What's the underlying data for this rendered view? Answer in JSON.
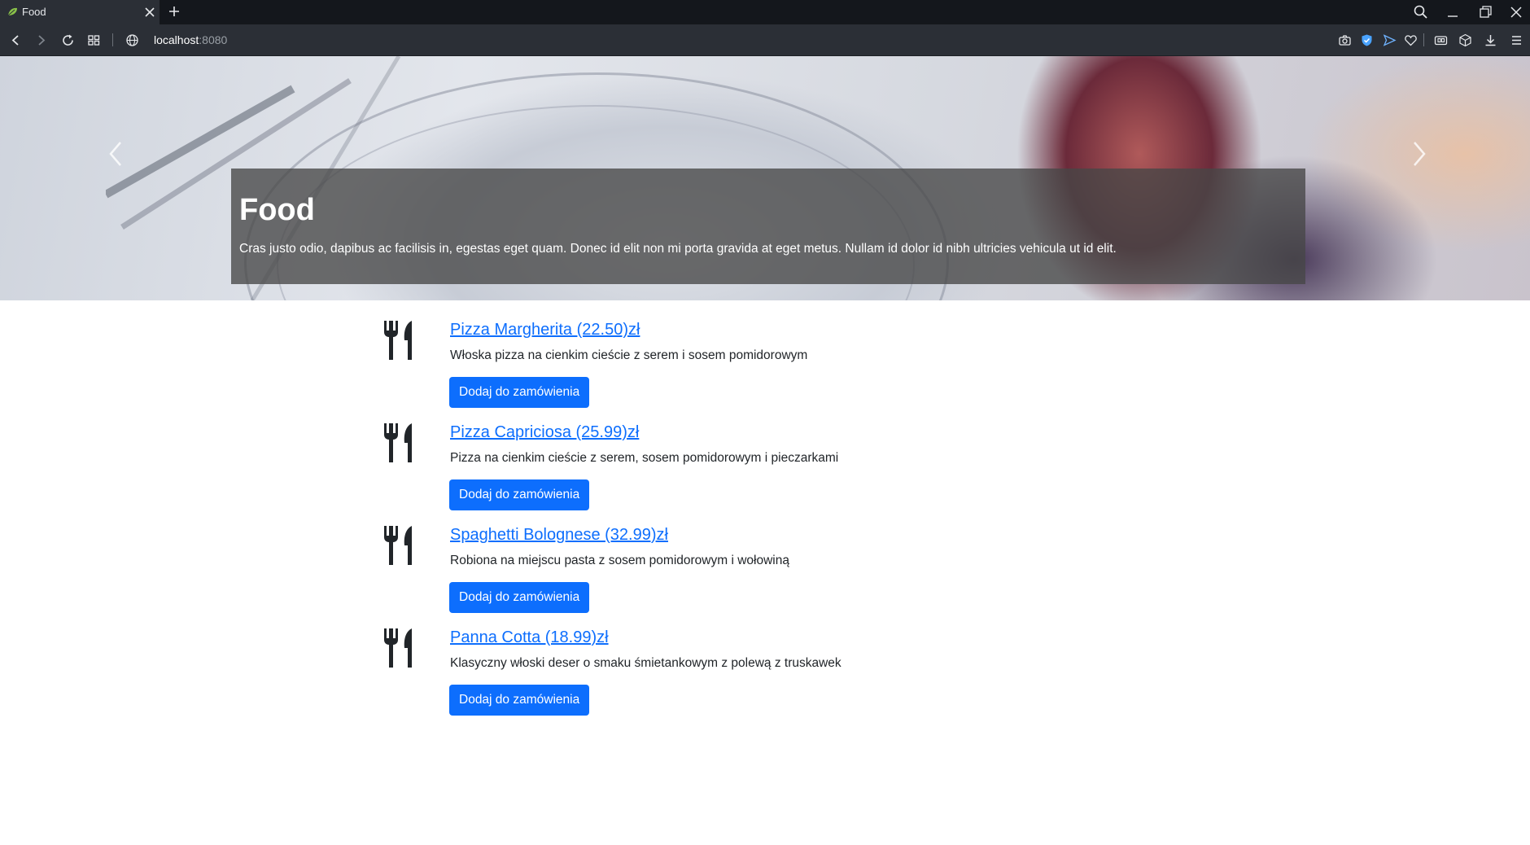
{
  "browser": {
    "tab_title": "Food",
    "url_host": "localhost",
    "url_port": ":8080",
    "icons": [
      "favicon-icon",
      "close-icon",
      "plus-icon",
      "search-icon",
      "minimize-icon",
      "restore-icon",
      "close-window-icon",
      "back-icon",
      "forward-icon",
      "reload-icon",
      "tiles-icon",
      "globe-icon",
      "camera-icon",
      "shield-icon",
      "send-icon",
      "heart-icon",
      "wallet-icon",
      "cube-icon",
      "download-icon",
      "menu-icon"
    ]
  },
  "hero": {
    "title": "Food",
    "text": "Cras justo odio, dapibus ac facilisis in, egestas eget quam. Donec id elit non mi porta gravida at eget metus. Nullam id dolor id nibh ultricies vehicula ut id elit.",
    "slides": 3,
    "active_slide": 1
  },
  "menu": {
    "button_label": "Dodaj do zamówienia",
    "items": [
      {
        "name": "Pizza Margherita (22.50)zł",
        "description": "Włoska pizza na cienkim cieście z serem i sosem pomidorowym"
      },
      {
        "name": "Pizza Capriciosa (25.99)zł",
        "description": "Pizza na cienkim cieście z serem, sosem pomidorowym i pieczarkami"
      },
      {
        "name": "Spaghetti Bolognese (32.99)zł",
        "description": "Robiona na miejscu pasta z sosem pomidorowym i wołowiną"
      },
      {
        "name": "Panna Cotta (18.99)zł",
        "description": "Klasyczny włoski deser o smaku śmietankowym z polewą z truskawek"
      }
    ]
  },
  "colors": {
    "primary": "#0d6efd",
    "chrome_dark": "#14171c",
    "chrome": "#2b2f36",
    "text": "#212529"
  }
}
